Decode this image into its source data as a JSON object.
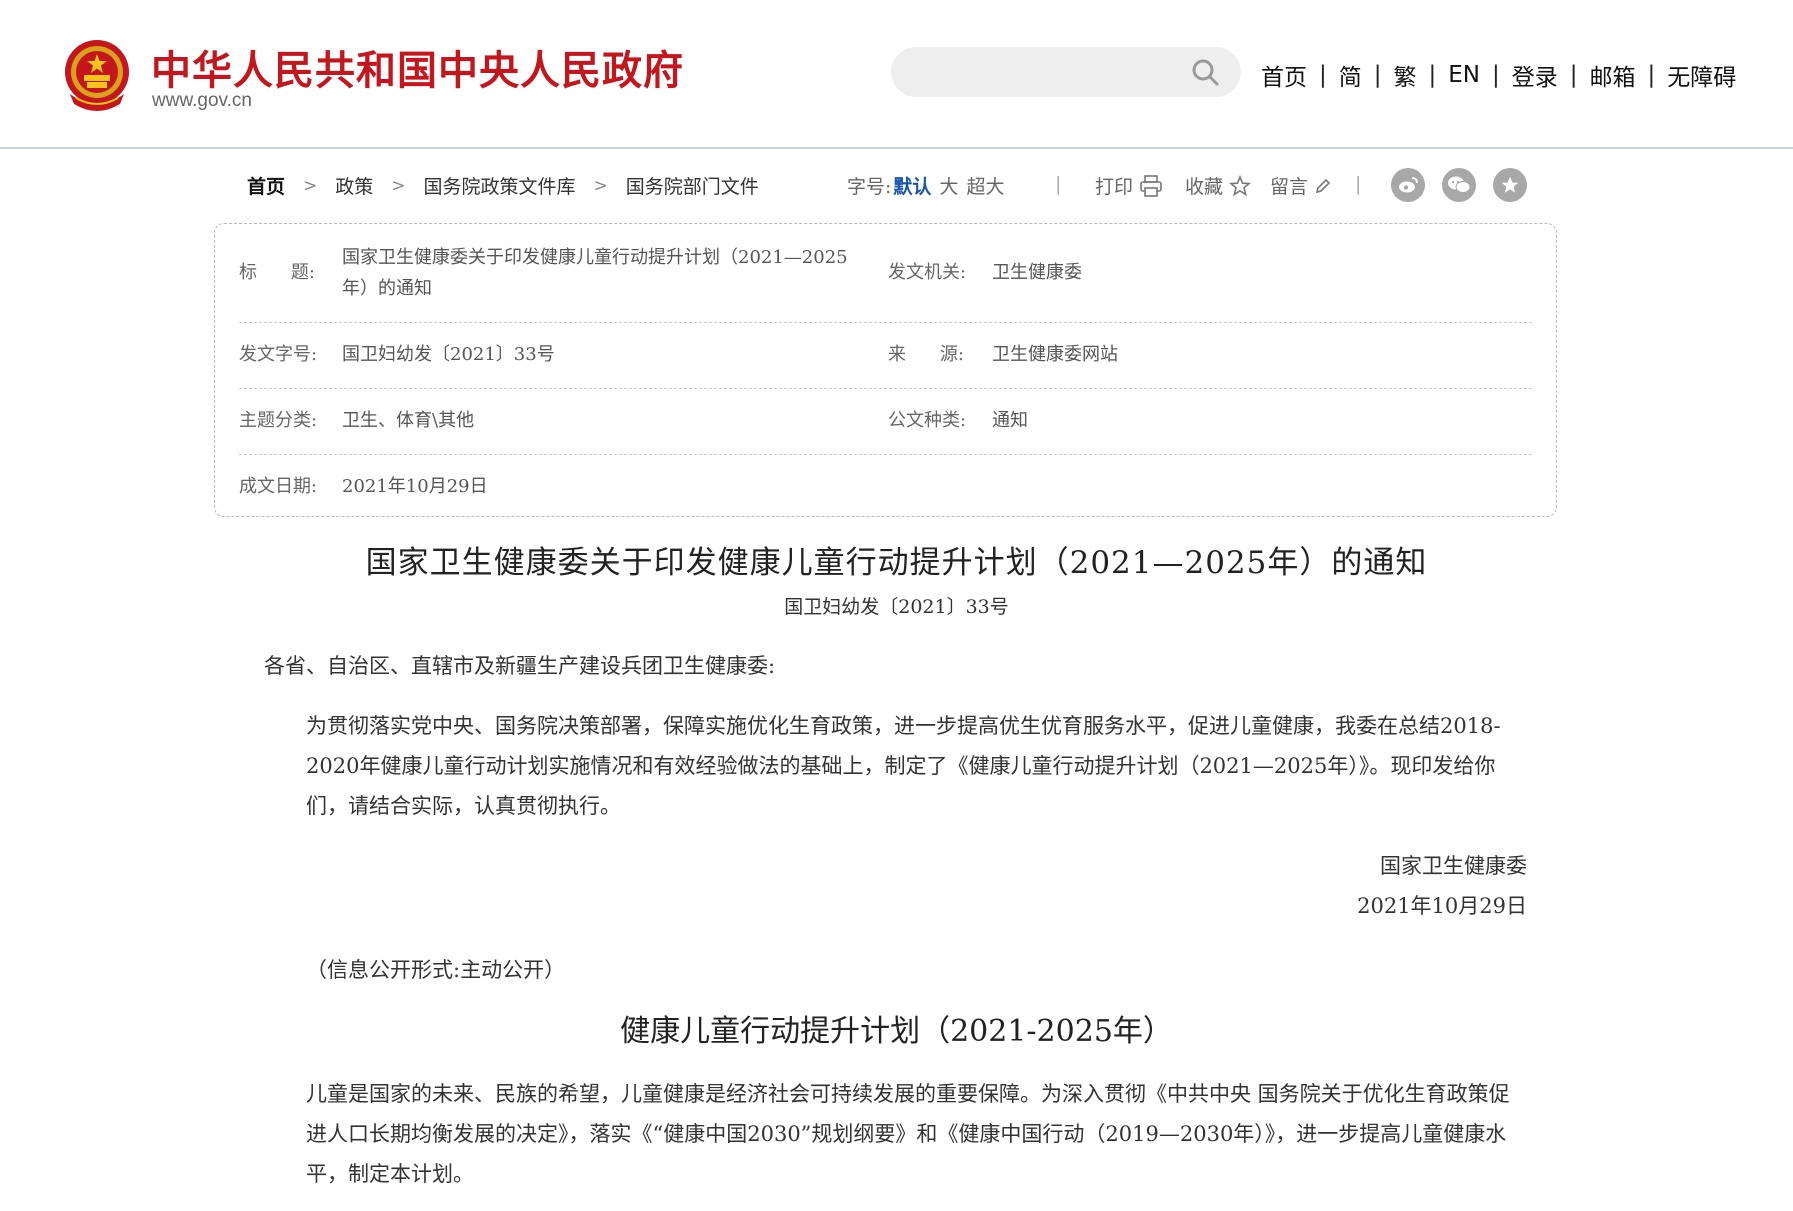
{
  "header": {
    "site_name": "中华人民共和国中央人民政府",
    "domain": "www.gov.cn",
    "search_placeholder": "",
    "nav": [
      "首页",
      "简",
      "繁",
      "EN",
      "登录",
      "邮箱",
      "无障碍"
    ]
  },
  "breadcrumb": [
    "首页",
    "政策",
    "国务院政策文件库",
    "国务院部门文件"
  ],
  "toolbar": {
    "font_size_label": "字号:",
    "font_sizes": [
      "默认",
      "大",
      "超大"
    ],
    "font_size_selected": "默认",
    "print_label": "打印",
    "favorite_label": "收藏",
    "comment_label": "留言"
  },
  "share_icons": [
    "weibo-icon",
    "wechat-icon",
    "favorite-circle-icon"
  ],
  "colors": {
    "brand_red": "#c4161c",
    "link_blue": "#1a56a8",
    "share_gray": "#a8a8a8"
  },
  "info": {
    "title_label": "标　　题:",
    "title_value": "国家卫生健康委关于印发健康儿童行动提升计划（2021—2025年）的通知",
    "issuer_label": "发文机关:",
    "issuer_value": "卫生健康委",
    "doc_no_label": "发文字号:",
    "doc_no_value": "国卫妇幼发〔2021〕33号",
    "source_label": "来　　源:",
    "source_value": "卫生健康委网站",
    "topic_label": "主题分类:",
    "topic_value": "卫生、体育\\其他",
    "type_label": "公文种类:",
    "type_value": "通知",
    "date_label": "成文日期:",
    "date_value": "2021年10月29日"
  },
  "document": {
    "title": "国家卫生健康委关于印发健康儿童行动提升计划（2021—2025年）的通知",
    "number": "国卫妇幼发〔2021〕33号",
    "salutation": "各省、自治区、直辖市及新疆生产建设兵团卫生健康委:",
    "body": "为贯彻落实党中央、国务院决策部署，保障实施优化生育政策，进一步提高优生优育服务水平，促进儿童健康，我委在总结2018-2020年健康儿童行动计划实施情况和有效经验做法的基础上，制定了《健康儿童行动提升计划（2021—2025年）》。现印发给你们，请结合实际，认真贯彻执行。",
    "signer": "国家卫生健康委",
    "sign_date": "2021年10月29日",
    "disclosure": "（信息公开形式:主动公开）",
    "plan_title": "健康儿童行动提升计划（2021-2025年）",
    "plan_intro": "儿童是国家的未来、民族的希望，儿童健康是经济社会可持续发展的重要保障。为深入贯彻《中共中央 国务院关于优化生育政策促进人口长期均衡发展的决定》，落实《“健康中国2030”规划纲要》和《健康中国行动（2019—2030年）》，进一步提高儿童健康水平，制定本计划。"
  }
}
